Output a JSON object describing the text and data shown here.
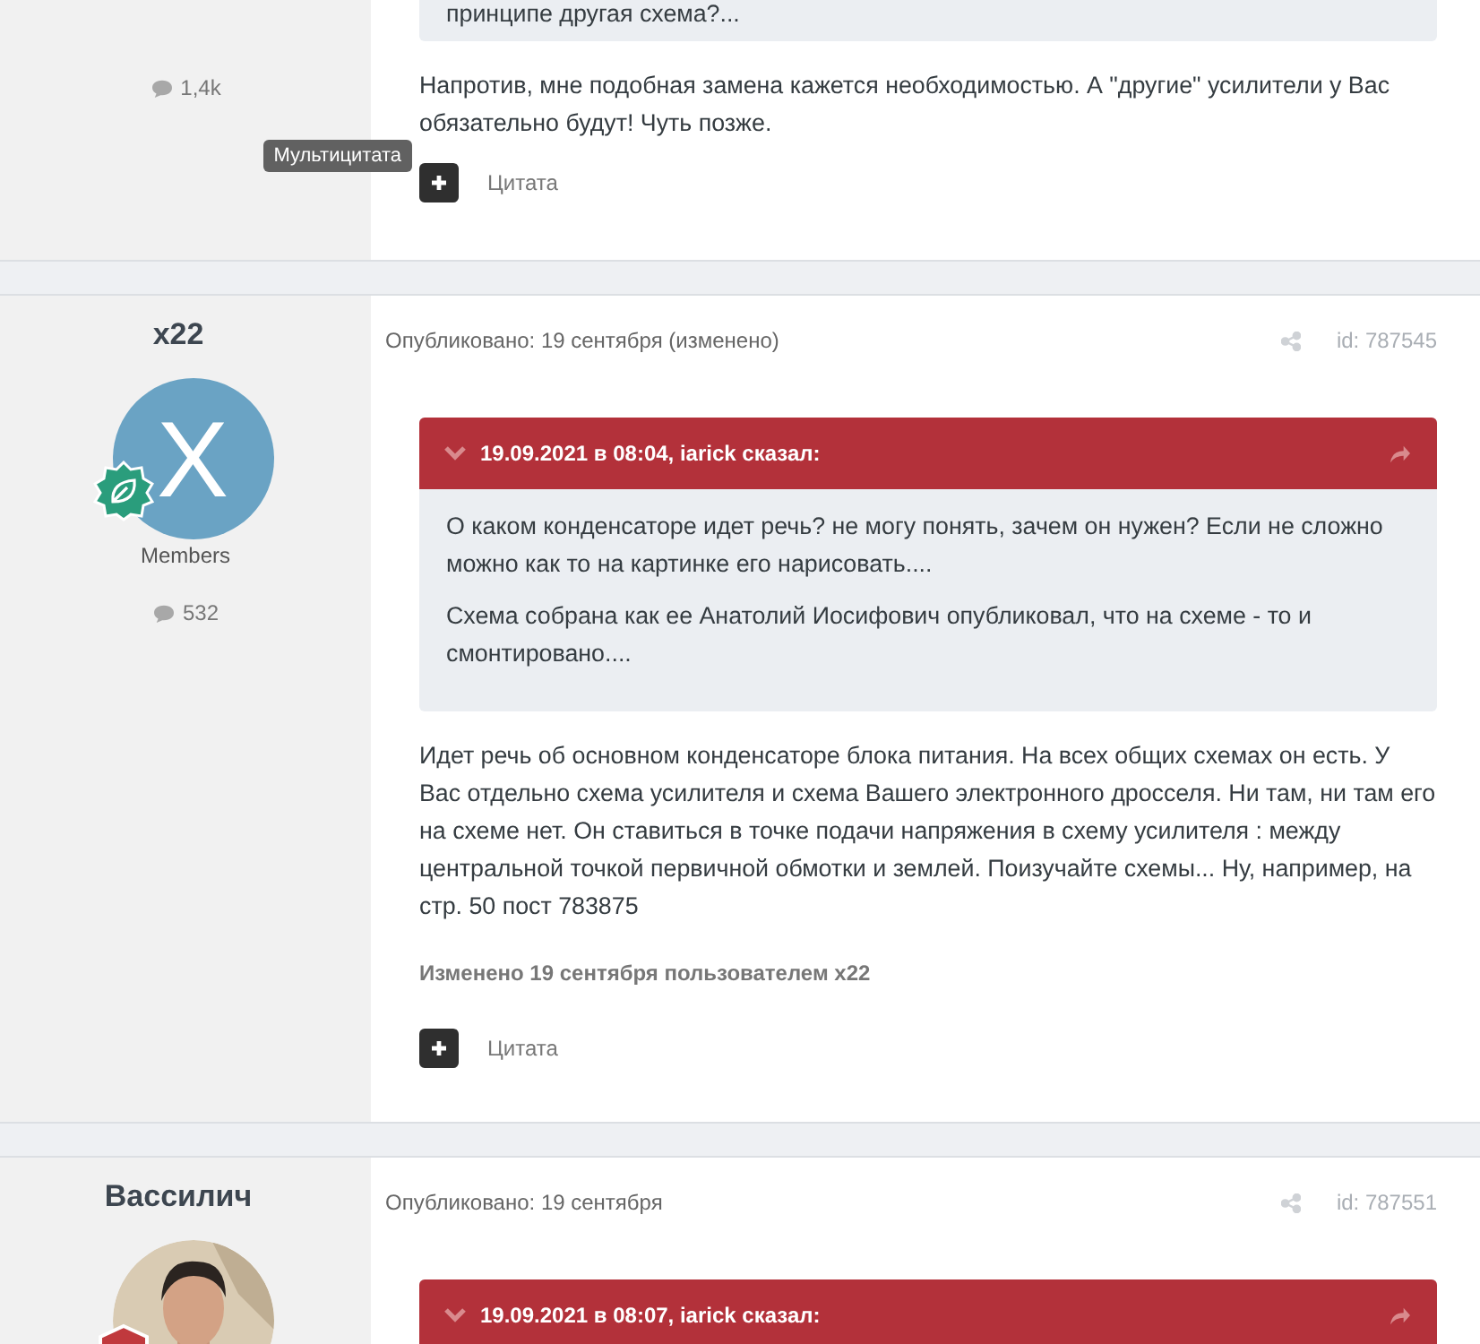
{
  "posts": [
    {
      "post_count": "1,4k",
      "quote": {
        "paragraphs": [
          "принципе другая схема?..."
        ]
      },
      "body": "Напротив, мне подобная замена кажется необходимостью.  А \"другие\" усилители у Вас обязательно будут! Чуть позже.",
      "multiquote_tooltip": "Мультицитата",
      "quote_button": "Цитата"
    },
    {
      "author": "x22",
      "avatar": {
        "kind": "letter",
        "letter": "X",
        "color": "#6aa3c4"
      },
      "badge": {
        "kind": "leaf"
      },
      "group": "Members",
      "post_count": "532",
      "posted": "Опубликовано: 19 сентября (изменено)",
      "post_id": "id: 787545",
      "quote": {
        "header": "19.09.2021 в 08:04, iarick сказал:",
        "paragraphs": [
          "О каком конденсаторе идет речь? не могу понять, зачем он нужен? Если не сложно можно как то на картинке его нарисовать....",
          "Схема собрана как ее Анатолий Иосифович опубликовал, что на схеме - то и смонтировано...."
        ]
      },
      "body": "Идет речь об основном конденсаторе блока питания. На всех общих схемах он есть. У Вас отдельно схема усилителя и схема Вашего электронного дросселя. Ни там, ни там его на схеме нет. Он ставиться в точке подачи напряжения в схему усилителя : между центральной точкой первичной обмотки и землей. Поизучайте схемы... Ну, например, на стр. 50 пост 783875",
      "edited": "Изменено 19 сентября пользователем x22",
      "quote_button": "Цитата"
    },
    {
      "author": "Вассилич",
      "badge": {
        "kind": "shield"
      },
      "posted": "Опубликовано: 19 сентября",
      "post_id": "id: 787551",
      "quote": {
        "header": "19.09.2021 в 08:07, iarick сказал:"
      }
    }
  ]
}
